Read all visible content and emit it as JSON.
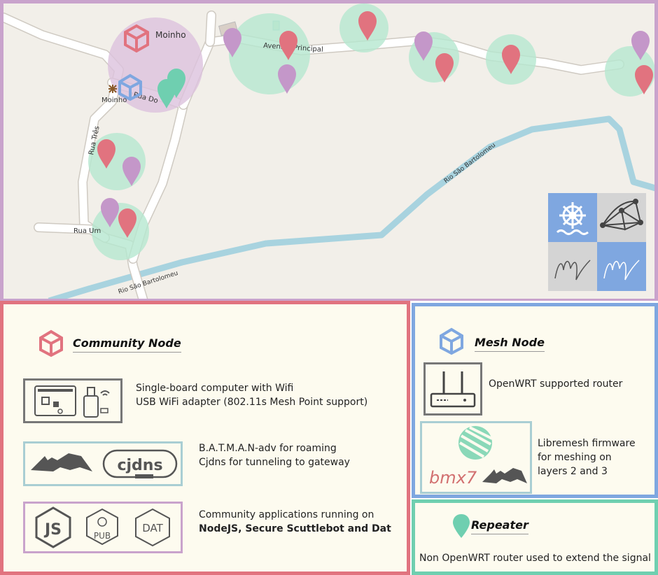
{
  "map": {
    "place_labels": {
      "moinho_top": "Moinho",
      "moinho_poi": "Moinho",
      "rua_dois": "Rua Do",
      "rua_tres": "Rua Três",
      "rua_um": "Rua Um",
      "avenida": "Avenida Principal",
      "rio_1": "Rio São Bartolomeu",
      "rio_2": "Rio São Bartolomeu"
    },
    "logos": [
      "ship-wheel-logo",
      "mesh-network-logo",
      "m-script-logo-gray",
      "m-script-logo-blue"
    ]
  },
  "colors": {
    "community": "#e1737f",
    "mesh": "#7fa7e0",
    "repeater": "#6fcfb0",
    "purple_border": "#c9a3cc",
    "panel_bg": "#fdfbef",
    "map_bg": "#f2efe9",
    "river": "#a8d3df",
    "purple_pin": "#c497c9",
    "green_circle": "#b5e7cf",
    "purple_circle": "#dcc2dd"
  },
  "community_panel": {
    "title": "Community Node",
    "hardware_line1": "Single-board computer with Wifi",
    "hardware_line2": "USB WiFi adapter (802.11s Mesh Point support)",
    "routing_line1": "B.A.T.M.A.N-adv for roaming",
    "routing_line2": "Cjdns for tunneling to gateway",
    "apps_line1": "Community applications running on",
    "apps_line2": "NodeJS, Secure Scuttlebot and Dat",
    "logo_cjdns": "cjdns",
    "logo_js": "JS",
    "logo_pub": "PUB",
    "logo_dat": "DAT"
  },
  "mesh_panel": {
    "title": "Mesh Node",
    "router_text": "OpenWRT supported router",
    "firmware_line1": "Libremesh firmware",
    "firmware_line2": "for meshing on",
    "firmware_line3": "layers 2 and 3",
    "logo_bmx": "bmx7"
  },
  "repeater_panel": {
    "title": "Repeater",
    "text": "Non OpenWRT router used to extend the signal"
  }
}
